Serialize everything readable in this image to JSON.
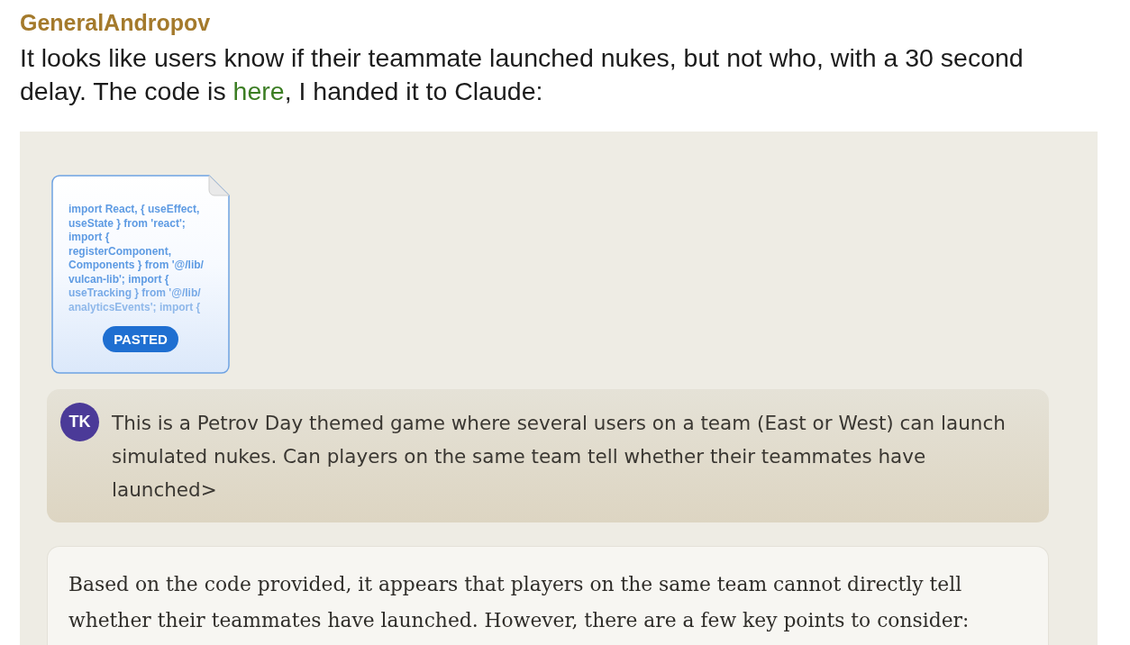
{
  "post": {
    "author": "GeneralAndropov",
    "text_before": "It looks like users know if their teammate launched nukes, but not who, with a 30 second delay. The code is ",
    "link": "here",
    "text_after": ", I handed it to Claude:"
  },
  "screenshot": {
    "attachment": {
      "preview_lines": [
        "import React, { useEffect,",
        "useState } from 'react';",
        "import {",
        "registerComponent,",
        "Components } from '@/lib/",
        "vulcan-lib'; import {",
        "useTracking } from '@/lib/",
        "analyticsEvents'; import {"
      ],
      "badge": "PASTED"
    },
    "messages": [
      {
        "kind": "user",
        "avatar": "TK",
        "text": "This is a Petrov Day themed game where several users on a team (East or West) can launch simulated nukes. Can players on the same team tell whether their teammates have launched>"
      },
      {
        "kind": "assistant",
        "text": "Based on the code provided, it appears that players on the same team cannot directly tell whether their teammates have launched. However, there are a few key points to consider:"
      }
    ]
  }
}
